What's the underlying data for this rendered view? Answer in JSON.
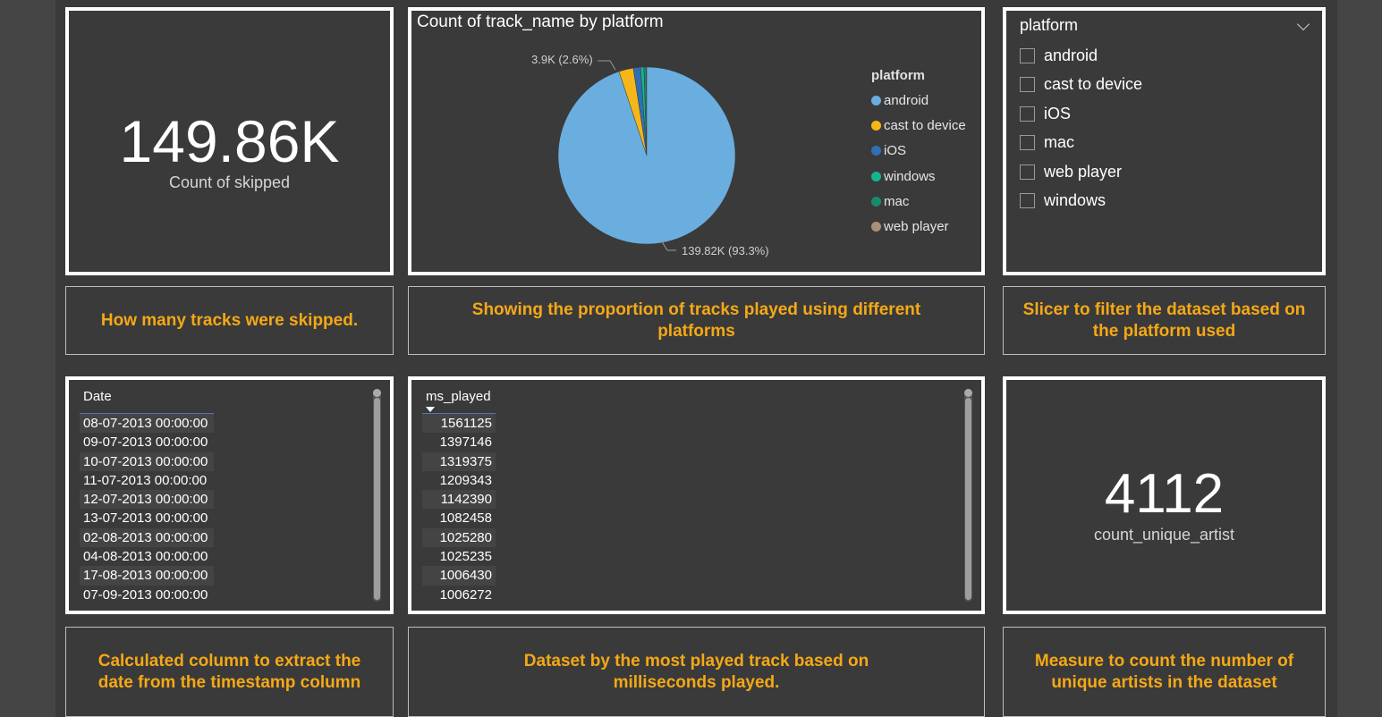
{
  "kpi_skipped": {
    "value": "149.86K",
    "label": "Count of skipped"
  },
  "pie": {
    "title": "Count of track_name by platform",
    "label_small": "3.9K (2.6%)",
    "label_large": "139.82K (93.3%)",
    "legend_title": "platform",
    "legend": [
      {
        "name": "android",
        "color": "#6aaee0"
      },
      {
        "name": "cast to device",
        "color": "#f5b717"
      },
      {
        "name": "iOS",
        "color": "#2f6fb5"
      },
      {
        "name": "windows",
        "color": "#16b48c"
      },
      {
        "name": "mac",
        "color": "#1a8a6c"
      },
      {
        "name": "web player",
        "color": "#a89078"
      }
    ]
  },
  "chart_data": {
    "type": "pie",
    "title": "Count of track_name by platform",
    "legend_title": "platform",
    "categories": [
      "android",
      "cast to device",
      "iOS",
      "windows",
      "mac",
      "web player"
    ],
    "values": [
      139820,
      3900,
      1950,
      900,
      650,
      80
    ],
    "labels": [
      {
        "category": "android",
        "text": "139.82K (93.3%)"
      },
      {
        "category": "cast to device",
        "text": "3.9K (2.6%)"
      }
    ],
    "legend_position": "right"
  },
  "slicer": {
    "header": "platform",
    "items": [
      "android",
      "cast to device",
      "iOS",
      "mac",
      "web player",
      "windows"
    ]
  },
  "descriptions": {
    "skipped": "How many tracks were skipped.",
    "pie": "Showing the proportion of tracks played using different platforms",
    "slicer": "Slicer to filter the dataset based on the platform used",
    "date": "Calculated column to extract the date from the timestamp column",
    "ms": "Dataset by the most played track based on milliseconds played.",
    "artist": "Measure to count the number of unique artists in the dataset"
  },
  "date_table": {
    "header": "Date",
    "rows": [
      "08-07-2013 00:00:00",
      "09-07-2013 00:00:00",
      "10-07-2013 00:00:00",
      "11-07-2013 00:00:00",
      "12-07-2013 00:00:00",
      "13-07-2013 00:00:00",
      "02-08-2013 00:00:00",
      "04-08-2013 00:00:00",
      "17-08-2013 00:00:00",
      "07-09-2013 00:00:00"
    ]
  },
  "ms_table": {
    "header": "ms_played",
    "rows": [
      "1561125",
      "1397146",
      "1319375",
      "1209343",
      "1142390",
      "1082458",
      "1025280",
      "1025235",
      "1006430",
      "1006272"
    ]
  },
  "kpi_artist": {
    "value": "4112",
    "label": "count_unique_artist"
  }
}
